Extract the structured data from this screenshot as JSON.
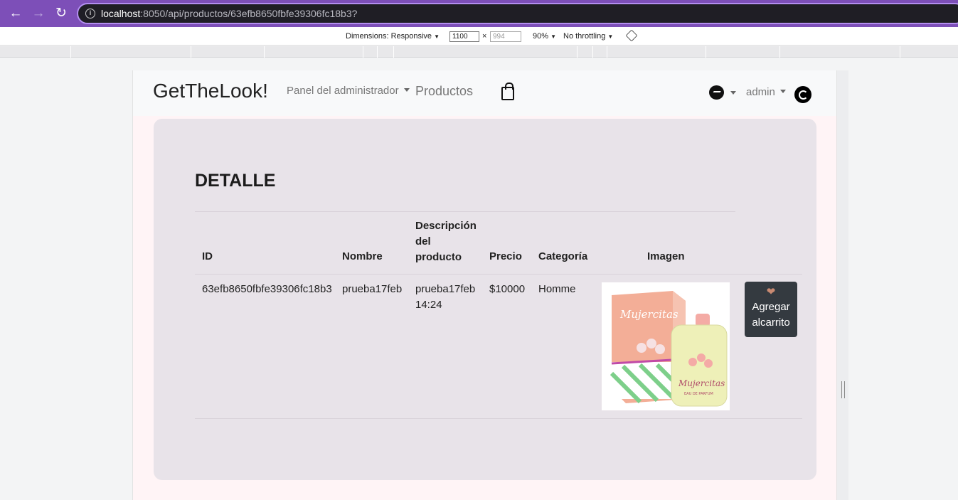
{
  "browser": {
    "url_host": "localhost",
    "url_path": ":8050/api/productos/63efb8650fbfe39306fc18b3?",
    "back_icon": "arrow-left-icon",
    "forward_icon": "arrow-right-icon",
    "reload_icon": "reload-icon"
  },
  "devtools": {
    "dimensions_label": "Dimensions: Responsive",
    "width_value": "1100",
    "times": "×",
    "height_placeholder": "994",
    "zoom": "90%",
    "throttle": "No throttling",
    "dropdown_glyph": "▼"
  },
  "navbar": {
    "brand": "GetTheLook!",
    "admin_panel": "Panel del administrador",
    "products": "Productos",
    "user": "admin",
    "cart_icon": "shopping-bag-icon",
    "chat_icon": "messenger-icon",
    "logout_icon": "logout-icon"
  },
  "detail": {
    "title": "DETALLE",
    "headers": {
      "id": "ID",
      "name": "Nombre",
      "desc_1": "Descripción",
      "desc_2": "del",
      "desc_3": "producto",
      "price": "Precio",
      "category": "Categoría",
      "image": "Imagen"
    },
    "row": {
      "id": "63efb8650fbfe39306fc18b3",
      "name": "prueba17feb",
      "desc_1": "prueba17feb",
      "desc_2": "14:24",
      "price": "$10000",
      "category": "Homme"
    },
    "image": {
      "brand_text": "Mujercitas",
      "sub_text": "EAU DE PARFUM",
      "box_color": "#f2a48d",
      "bottle_color": "#eef0b8"
    },
    "cart_button": {
      "heart": "❤",
      "line_1": "Agregar",
      "line_2": "alcarrito"
    }
  },
  "colors": {
    "browser_accent": "#7d4fb8",
    "card_bg": "#e8e3e9",
    "button_dark": "#343a40"
  }
}
